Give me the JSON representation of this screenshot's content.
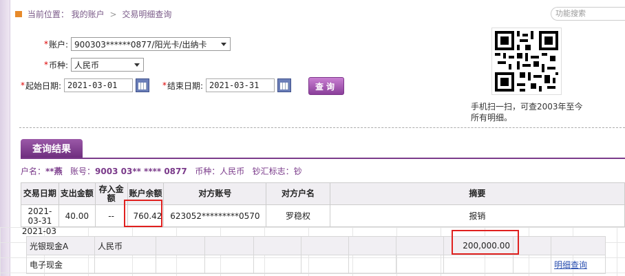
{
  "breadcrumb": {
    "prefix": "当前位置：",
    "item1": "我的账户",
    "sep": ">",
    "item2": "交易明细查询"
  },
  "top_search": {
    "placeholder": "功能搜索"
  },
  "form": {
    "account_label": "账户:",
    "account_value": "900303******0877/阳光卡/出纳卡",
    "currency_label": "币种:",
    "currency_value": "人民币",
    "start_label": "起始日期:",
    "start_value": "2021-03-01",
    "end_label": "结束日期:",
    "end_value": "2021-03-31",
    "query_button": "查询"
  },
  "qr": {
    "caption": "手机扫一扫，可查2003年至今所有明细。"
  },
  "results": {
    "tab_label": "查询结果",
    "info": {
      "name_label": "户名：",
      "name_value": "**燕",
      "acct_label": "账号：",
      "acct_value": "9003 03** **** 0877",
      "cur_label": "币种：",
      "cur_value": "人民币",
      "flag_label": "钞汇标志：",
      "flag_value": "钞"
    },
    "columns": [
      "交易日期",
      "支出金额",
      "存入金额",
      "账户余额",
      "对方账号",
      "对方户名",
      "摘要"
    ],
    "rows": [
      {
        "date": "2021-03-31",
        "out": "40.00",
        "in": "--",
        "balance": "760.42",
        "counter_acct": "623052*********0570",
        "counter_name": "罗稳权",
        "memo": "报销"
      }
    ],
    "partial_row_date": "2021-03"
  },
  "balances": {
    "rows": [
      {
        "name": "光银现金A",
        "currency": "人民币",
        "amount": "200,000.00",
        "link": ""
      },
      {
        "name": "电子现金",
        "currency": "",
        "amount": "",
        "link": "明细查询"
      }
    ]
  }
}
